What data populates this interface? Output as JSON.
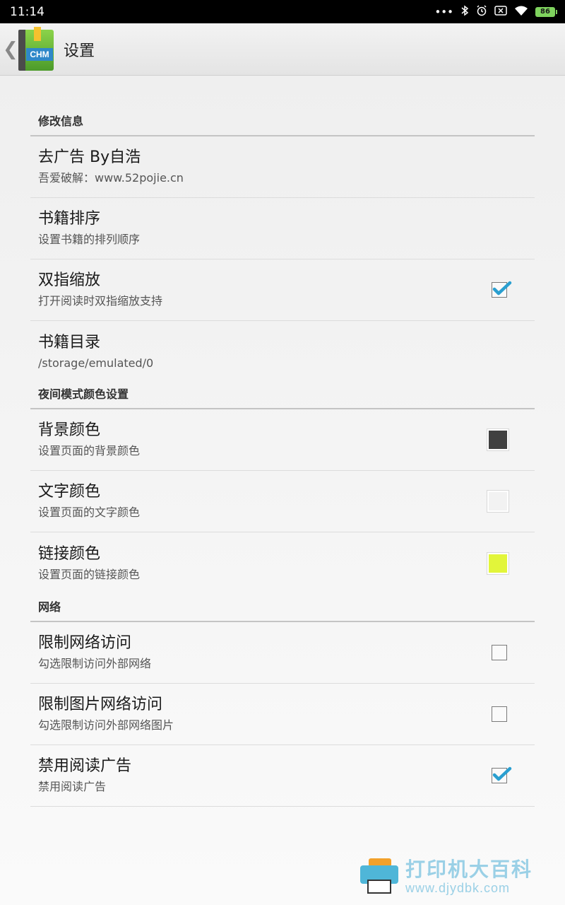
{
  "status_bar": {
    "time": "11:14",
    "icons": [
      "more-dots-icon",
      "bluetooth-icon",
      "alarm-icon",
      "screen-icon",
      "wifi-icon"
    ],
    "battery": "86"
  },
  "action_bar": {
    "back": "❮",
    "app_icon_label": "CHM",
    "title": "设置"
  },
  "categories": [
    {
      "title": "修改信息",
      "items": [
        {
          "title": "去广告 By自浩",
          "summary": "吾爱破解：www.52pojie.cn",
          "widget": "none"
        },
        {
          "title": "书籍排序",
          "summary": "设置书籍的排列顺序",
          "widget": "none"
        },
        {
          "title": "双指缩放",
          "summary": "打开阅读时双指缩放支持",
          "widget": "checkbox",
          "checked": true
        },
        {
          "title": "书籍目录",
          "summary": "/storage/emulated/0",
          "widget": "none"
        }
      ]
    },
    {
      "title": "夜间模式颜色设置",
      "items": [
        {
          "title": "背景颜色",
          "summary": "设置页面的背景颜色",
          "widget": "color",
          "color": "#404040"
        },
        {
          "title": "文字颜色",
          "summary": "设置页面的文字颜色",
          "widget": "color",
          "color": "#f2f2f2"
        },
        {
          "title": "链接颜色",
          "summary": "设置页面的链接颜色",
          "widget": "color",
          "color": "#e2f53a"
        }
      ]
    },
    {
      "title": "网络",
      "items": [
        {
          "title": "限制网络访问",
          "summary": "勾选限制访问外部网络",
          "widget": "checkbox",
          "checked": false
        },
        {
          "title": "限制图片网络访问",
          "summary": "勾选限制访问外部网络图片",
          "widget": "checkbox",
          "checked": false
        },
        {
          "title": "禁用阅读广告",
          "summary": "禁用阅读广告",
          "widget": "checkbox",
          "checked": true
        }
      ]
    }
  ],
  "colors": {
    "check_accent": "#2a9fd0"
  },
  "watermark": {
    "cn": "打印机大百科",
    "url": "www.djydbk.com"
  }
}
